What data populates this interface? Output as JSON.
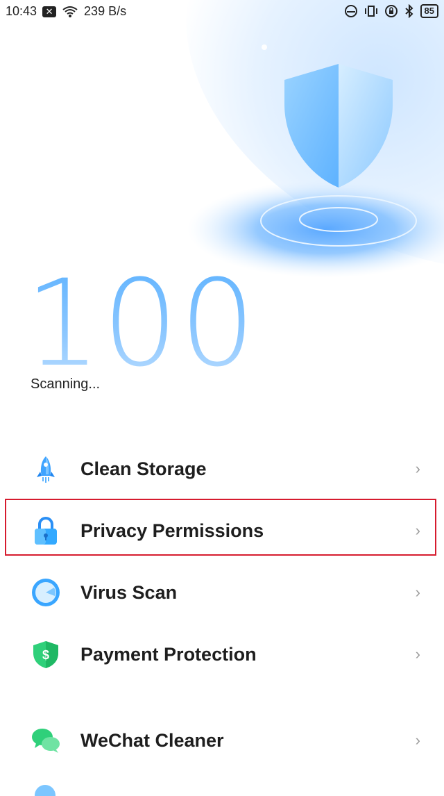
{
  "status_bar": {
    "time": "10:43",
    "network_speed": "239 B/s",
    "battery": "85",
    "icons": [
      "notification-x-icon",
      "wifi-icon",
      "face-icon",
      "vibrate-icon",
      "alarm-lock-icon",
      "bluetooth-icon",
      "battery-icon"
    ]
  },
  "hero": {
    "score": "100",
    "status": "Scanning..."
  },
  "menu": {
    "items": [
      {
        "label": "Clean Storage",
        "icon": "rocket-icon"
      },
      {
        "label": "Privacy Permissions",
        "icon": "lock-icon"
      },
      {
        "label": "Virus Scan",
        "icon": "radar-icon"
      },
      {
        "label": "Payment Protection",
        "icon": "shield-dollar-icon"
      },
      {
        "label": "WeChat Cleaner",
        "icon": "chat-bubbles-icon"
      }
    ],
    "chevron": "›"
  },
  "colors": {
    "accent": "#4aa8ff",
    "highlight_border": "#d61b2e",
    "green": "#2fd07a"
  }
}
